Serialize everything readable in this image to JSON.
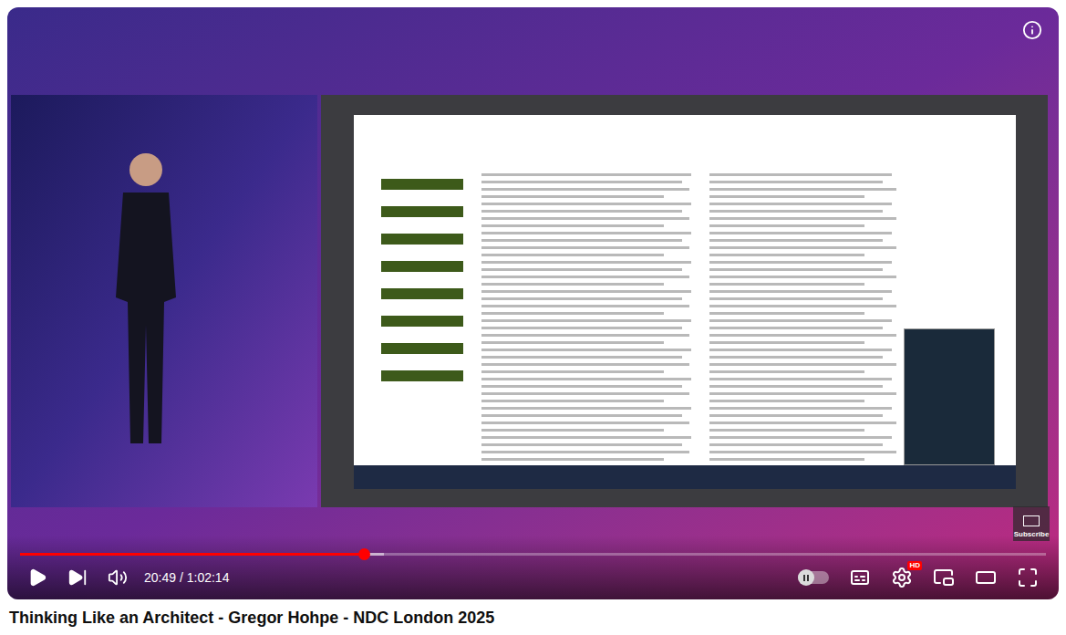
{
  "video": {
    "title": "Thinking Like an Architect - Gregor Hohpe - NDC London 2025"
  },
  "player": {
    "played": 0.335,
    "buffered": 0.355,
    "time": "20:49 / 1:02:14",
    "muted": false,
    "autoplay": {
      "on": false
    },
    "quality_badge": "HD"
  },
  "watermark": {
    "label": "Subscribe"
  }
}
